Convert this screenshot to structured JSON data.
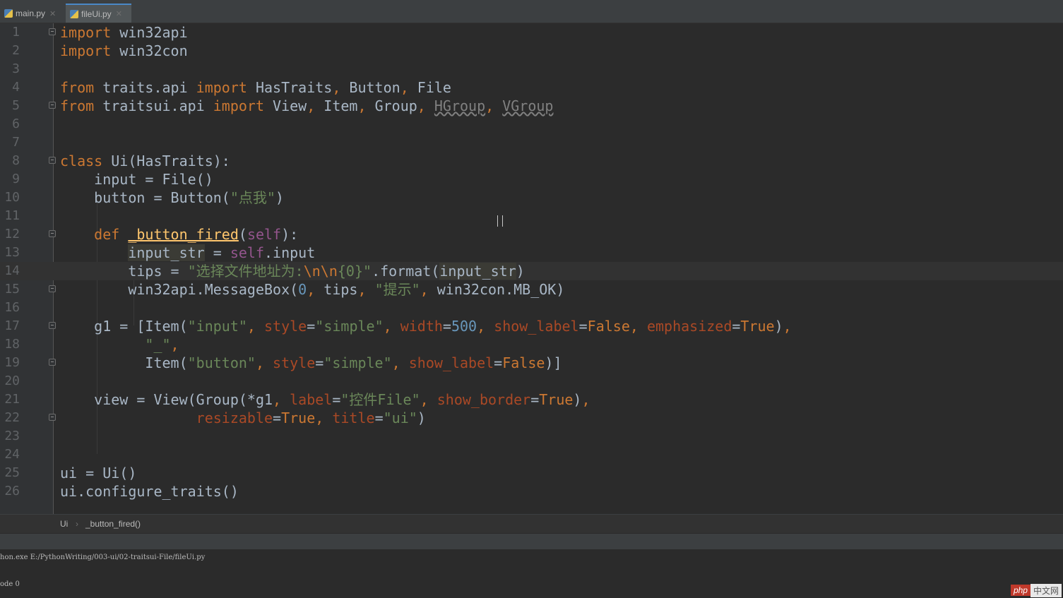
{
  "tabs": [
    {
      "label": "main.py",
      "icon": "python-file-icon",
      "active": false
    },
    {
      "label": "fileUi.py",
      "icon": "python-file-icon",
      "active": true
    }
  ],
  "editor": {
    "line_numbers": [
      "1",
      "2",
      "3",
      "4",
      "5",
      "6",
      "7",
      "8",
      "9",
      "10",
      "11",
      "12",
      "13",
      "14",
      "15",
      "16",
      "17",
      "18",
      "19",
      "20",
      "21",
      "22",
      "23",
      "24",
      "25",
      "26"
    ],
    "lines": [
      "import win32api",
      "import win32con",
      "",
      "from traits.api import HasTraits, Button, File",
      "from traitsui.api import View, Item, Group, HGroup, VGroup",
      "",
      "",
      "class Ui(HasTraits):",
      "    input = File()",
      "    button = Button(\"点我\")",
      "",
      "    def _button_fired(self):",
      "        input_str = self.input",
      "        tips = \"选择文件地址为:\\n\\n{0}\".format(input_str)",
      "        win32api.MessageBox(0, tips, \"提示\", win32con.MB_OK)",
      "",
      "    g1 = [Item(\"input\", style=\"simple\", width=500, show_label=False, emphasized=True),",
      "          \"_\",",
      "          Item(\"button\", style=\"simple\", show_label=False)]",
      "",
      "    view = View(Group(*g1, label=\"控件File\", show_border=True),",
      "                resizable=True, title=\"ui\")",
      "",
      "",
      "ui = Ui()",
      "ui.configure_traits()"
    ],
    "current_line": "14"
  },
  "breadcrumb": {
    "class_name": "Ui",
    "separator": "›",
    "method_name": "_button_fired()"
  },
  "console": {
    "line1": "hon.exe E:/PythonWriting/003-ui/02-traitsui-File/fileUi.py",
    "line2": "ode 0"
  },
  "watermark": {
    "part1": "php",
    "part2": "中文网"
  }
}
